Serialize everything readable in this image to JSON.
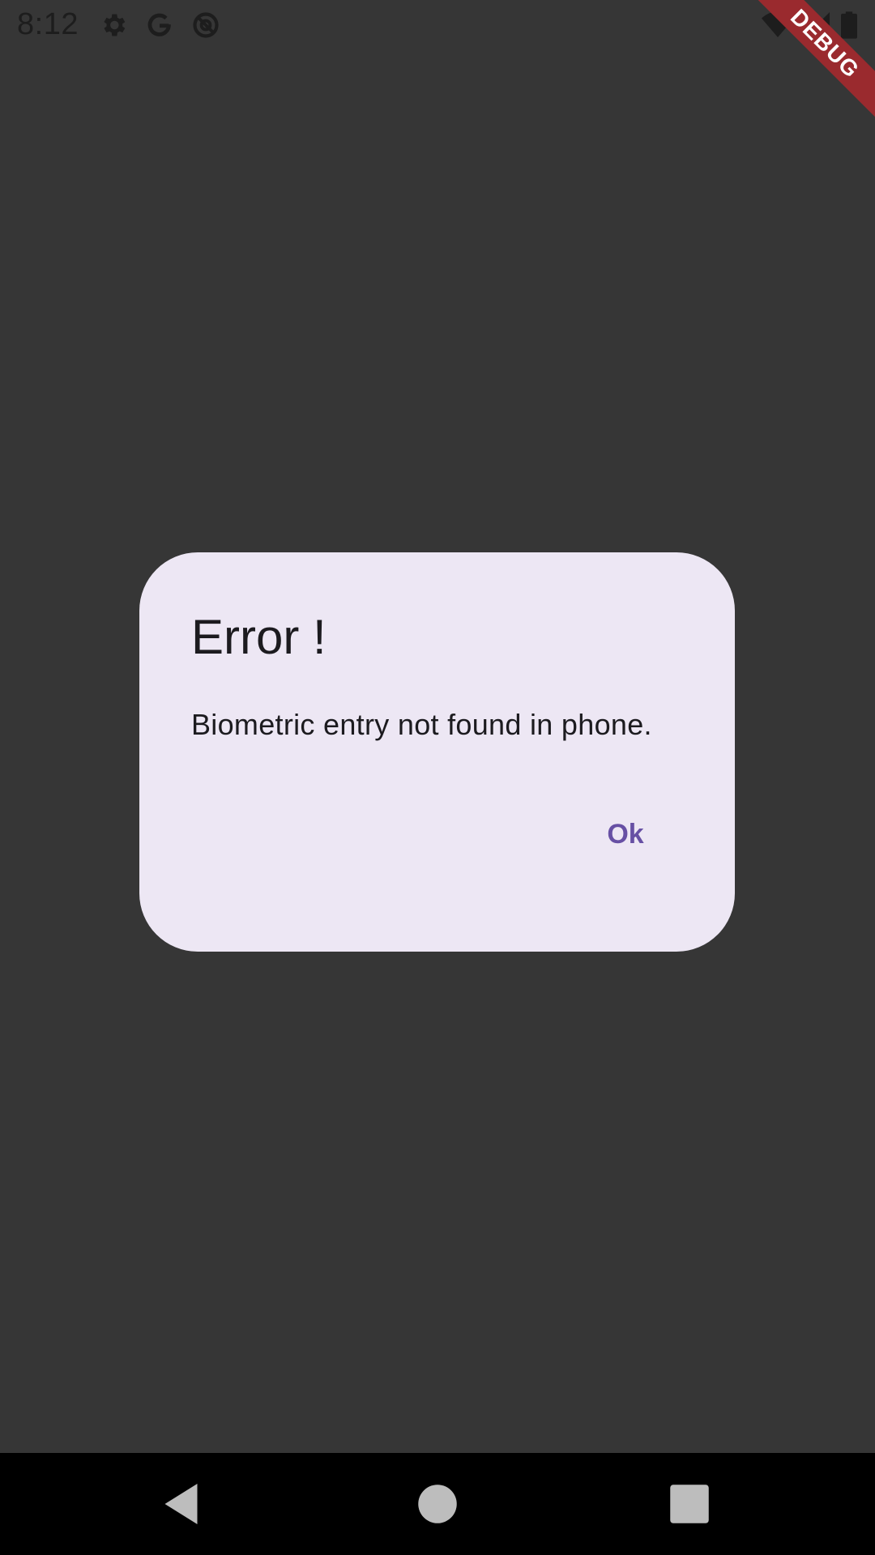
{
  "status_bar": {
    "time": "8:12",
    "left_icons": [
      "gear-icon",
      "google-icon",
      "at-sign-icon"
    ],
    "right_icons": [
      "wifi-icon",
      "signal-icon",
      "battery-icon"
    ]
  },
  "debug_banner": {
    "label": "DEBUG",
    "color": "#9a2a2e"
  },
  "dialog": {
    "title": "Error !",
    "message": "Biometric entry not found in phone.",
    "ok_label": "Ok",
    "background": "#ede7f4",
    "accent": "#6750a4"
  },
  "nav_bar": {
    "buttons": [
      "back-icon",
      "home-icon",
      "recents-icon"
    ]
  }
}
